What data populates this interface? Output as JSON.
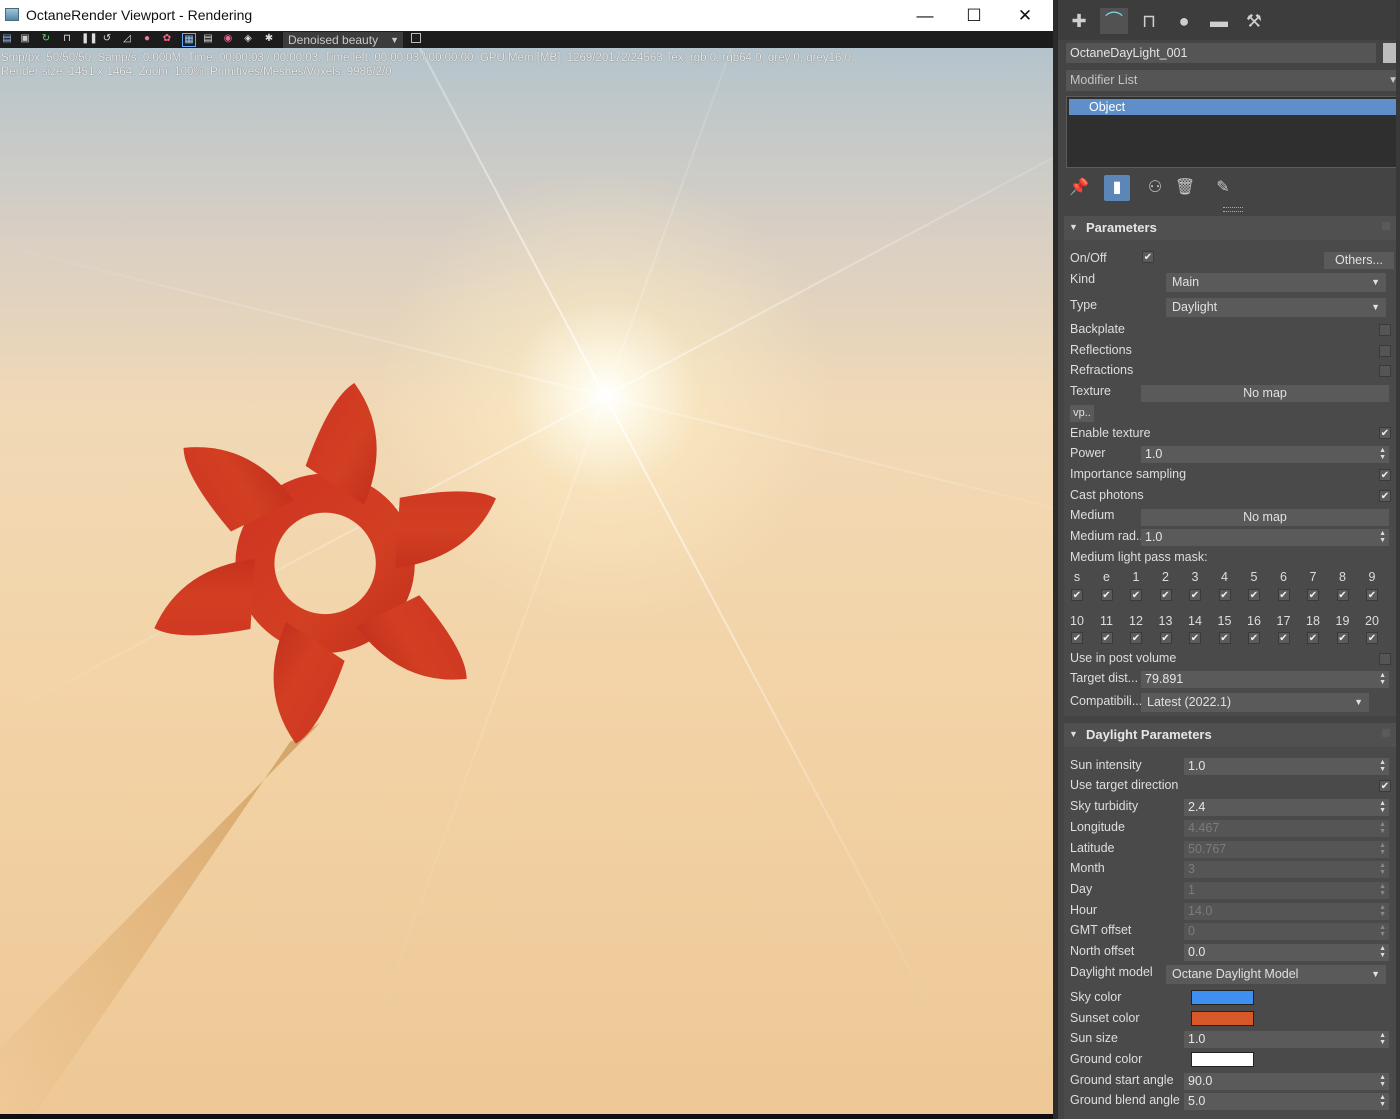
{
  "window": {
    "title": "OctaneRender Viewport - Rendering",
    "minimize": "—",
    "maximize": "☐",
    "close": "✕"
  },
  "toolbar": {
    "pass_select": "Denoised beauty"
  },
  "status": {
    "line1": "Smp/px: 50/50/50.  Samp/s: 0.000M.  Time: 00:00:03 / 00:00:03.  Time left: 00:00:03 / 00:00:00.  GPU Mem [MB]: 1269/20172/24563  Tex: rgb 0, rgb64 0, grey 0, grey16 0.",
    "line2": "Render size: 1451 x 1464.  Zoom: 100%.  Primitives/Meshes/Voxels: 9986/2/0"
  },
  "panel": {
    "object_name": "OctaneDayLight_001",
    "modifier_list": "Modifier List",
    "stack_item": "Object",
    "parameters": {
      "title": "Parameters",
      "on_off": "On/Off",
      "others_button": "Others...",
      "kind_label": "Kind",
      "kind_value": "Main",
      "type_label": "Type",
      "type_value": "Daylight",
      "backplate": "Backplate",
      "reflections": "Reflections",
      "refractions": "Refractions",
      "texture_label": "Texture",
      "texture_value": "No map",
      "vp_button": "vp..",
      "enable_texture": "Enable texture",
      "power_label": "Power",
      "power_value": "1.0",
      "importance_sampling": "Importance sampling",
      "cast_photons": "Cast photons",
      "medium_label": "Medium",
      "medium_value": "No map",
      "medium_rad_label": "Medium rad...",
      "medium_rad_value": "1.0",
      "mask_label": "Medium light pass mask:",
      "mask_row1": [
        "s",
        "e",
        "1",
        "2",
        "3",
        "4",
        "5",
        "6",
        "7",
        "8",
        "9"
      ],
      "mask_row2": [
        "10",
        "11",
        "12",
        "13",
        "14",
        "15",
        "16",
        "17",
        "18",
        "19",
        "20"
      ],
      "use_in_post_volume": "Use in post volume",
      "target_dist_label": "Target dist...",
      "target_dist_value": "79.891",
      "compat_label": "Compatibili...",
      "compat_value": "Latest (2022.1)"
    },
    "daylight": {
      "title": "Daylight Parameters",
      "sun_intensity_label": "Sun intensity",
      "sun_intensity_value": "1.0",
      "use_target_direction": "Use target direction",
      "sky_turbidity_label": "Sky turbidity",
      "sky_turbidity_value": "2.4",
      "longitude_label": "Longitude",
      "longitude_value": "4.467",
      "latitude_label": "Latitude",
      "latitude_value": "50.767",
      "month_label": "Month",
      "month_value": "3",
      "day_label": "Day",
      "day_value": "1",
      "hour_label": "Hour",
      "hour_value": "14.0",
      "gmt_label": "GMT offset",
      "gmt_value": "0",
      "north_label": "North offset",
      "north_value": "0.0",
      "model_label": "Daylight model",
      "model_value": "Octane Daylight Model",
      "sky_color_label": "Sky color",
      "sunset_color_label": "Sunset color",
      "sun_size_label": "Sun size",
      "sun_size_value": "1.0",
      "ground_color_label": "Ground color",
      "ground_start_label": "Ground start angle",
      "ground_start_value": "90.0",
      "ground_blend_label": "Ground blend angle",
      "ground_blend_value": "5.0"
    }
  },
  "colors": {
    "sky_color": "#3f8ff0",
    "sunset_color": "#d9582a",
    "ground_color": "#ffffff",
    "logo_red": "#cf3323",
    "selection_blue": "#5f8fc9"
  },
  "icons": [
    "app-icon",
    "start-icon",
    "pause-icon",
    "restart-icon",
    "lock-icon",
    "settings-icon",
    "create-tab-icon",
    "modify-tab-icon",
    "hierarchy-tab-icon",
    "motion-tab-icon",
    "display-tab-icon",
    "utilities-tab-icon",
    "pin-icon",
    "show-result-icon",
    "make-unique-icon",
    "remove-modifier-icon",
    "configure-icon"
  ]
}
